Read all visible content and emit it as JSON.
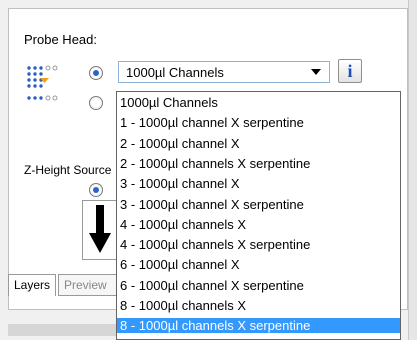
{
  "probe_head": {
    "label": "Probe Head:",
    "selected": "1000µl Channels",
    "info_label": "i"
  },
  "z_height": {
    "label": "Z-Height Source"
  },
  "tabs": [
    "Layers",
    "Preview"
  ],
  "dropdown": {
    "items": [
      "1000µl Channels",
      "1 - 1000µl channel X serpentine",
      "2 - 1000µl channel X",
      "2 - 1000µl channels X serpentine",
      "3 - 1000µl channel X",
      "3 - 1000µl channel X serpentine",
      "4 - 1000µl channels X",
      "4 - 1000µl channels X serpentine",
      "6 - 1000µl channel X",
      "6 - 1000µl channel X serpentine",
      "8 - 1000µl channels X",
      "8 - 1000µl channels X serpentine"
    ],
    "highlighted_index": 11
  },
  "colors": {
    "highlight": "#3399ff",
    "info_icon": "#1d4fb8",
    "accent_orange": "#f0a020"
  }
}
